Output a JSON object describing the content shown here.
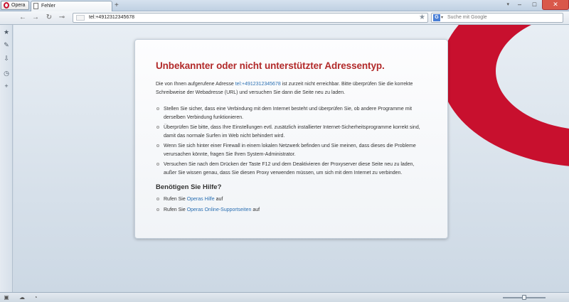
{
  "titlebar": {
    "opera_button": "Opera",
    "tab_title": "Fehler",
    "new_tab": "+",
    "minimize": "–",
    "maximize": "□",
    "close": "✕",
    "tab_menu": "▾"
  },
  "navbar": {
    "back": "←",
    "forward": "→",
    "reload": "↻",
    "key": "⊸",
    "address_value": "tel:+4912312345678",
    "bookmark_star": "★",
    "search_engine": "G",
    "search_dropdown": "▾",
    "search_placeholder": "Suche mit Google"
  },
  "sidebar": {
    "items": [
      {
        "glyph": "★"
      },
      {
        "glyph": "✎"
      },
      {
        "glyph": "⇩"
      },
      {
        "glyph": "◷"
      },
      {
        "glyph": "+"
      }
    ]
  },
  "error": {
    "title": "Unbekannter oder nicht unterstützter Adressentyp.",
    "intro_prefix": "Die von Ihnen aufgerufene Adresse",
    "intro_link": "tel:+4912312345678",
    "intro_suffix": "ist zurzeit nicht erreichbar. Bitte überprüfen Sie die korrekte Schreibweise der Webadresse (URL) und versuchen Sie dann die Seite neu zu laden.",
    "bullets": [
      "Stellen Sie sicher, dass eine Verbindung mit dem Internet besteht und überprüfen Sie, ob andere Programme mit derselben Verbindung funktionieren.",
      "Überprüfen Sie bitte, dass Ihre Einstellungen evtl. zusätzlich installierter Internet-Sicherheitsprogramme korrekt sind, damit das normale Surfen im Web nicht behindert wird.",
      "Wenn Sie sich hinter einer Firewall in einem lokalen Netzwerk befinden und Sie meinen, dass dieses die Probleme verursachen könnte, fragen Sie Ihren System-Administrator.",
      "Versuchen Sie nach dem Drücken der Taste F12 und dem Deaktivieren der Proxyserver diese Seite neu zu laden, außer Sie wissen genau, dass Sie diesen Proxy verwenden müssen, um sich mit dem Internet zu verbinden."
    ],
    "help_heading": "Benötigen Sie Hilfe?",
    "help_items": [
      {
        "prefix": "Rufen Sie",
        "link": "Operas Hilfe",
        "suffix": "auf"
      },
      {
        "prefix": "Rufen Sie",
        "link": "Operas Online-Supportseiten",
        "suffix": "auf"
      }
    ]
  },
  "statusbar": {
    "panel_icon": "▣",
    "cloud_icon": "☁",
    "speed_icon": "◔",
    "zoom_level_percent": 50
  },
  "colors": {
    "title_red": "#b22a2a",
    "link_blue": "#2a6fb2",
    "opera_red": "#c8102e"
  }
}
